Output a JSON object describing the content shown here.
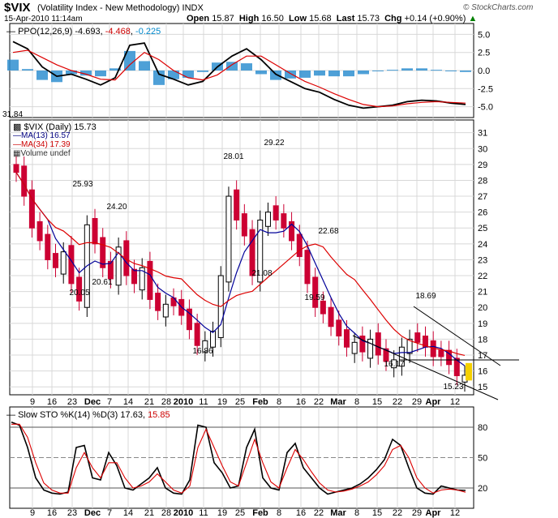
{
  "header": {
    "symbol": "$VIX",
    "name": "(Volatility Index - New Methodology)",
    "exchange": "INDX",
    "date": "15-Apr-2010 11:14am",
    "open_label": "Open",
    "open": "15.87",
    "high_label": "High",
    "high": "16.50",
    "low_label": "Low",
    "low": "15.68",
    "last_label": "Last",
    "last": "15.73",
    "chg_label": "Chg",
    "chg": "+0.14 (+0.90%)",
    "logo": "© StockCharts.com"
  },
  "ppo_panel": {
    "label": "PPO(12,26,9)",
    "v1": "-4.693",
    "v2": "-4.468",
    "v3": "-0.225",
    "ticks": [
      "5.0",
      "2.5",
      "0.0",
      "-2.5",
      "-5.0"
    ]
  },
  "price_panel": {
    "legend_main": "$VIX (Daily) 15.73",
    "legend_ma13": "MA(13) 16.57",
    "legend_ma34": "MA(34) 17.39",
    "legend_vol": "Volume undef",
    "left_value": "31.84",
    "ticks": [
      "31",
      "30",
      "29",
      "28",
      "27",
      "26",
      "25",
      "24",
      "23",
      "22",
      "21",
      "20",
      "19",
      "18",
      "17",
      "16",
      "15"
    ],
    "annotations": [
      "25.93",
      "24.20",
      "20.61",
      "20.05",
      "28.01",
      "29.22",
      "16.86",
      "21.08",
      "22.68",
      "19.59",
      "16.17",
      "18.69",
      "15.23"
    ]
  },
  "stoch_panel": {
    "label": "Slow STO %K(14) %D(3)",
    "k": "17.63",
    "d": "15.85",
    "ticks": [
      "80",
      "50",
      "20"
    ]
  },
  "x_axis": [
    "9",
    "16",
    "23",
    "Dec",
    "7",
    "14",
    "21",
    "28",
    "2010",
    "11",
    "19",
    "25",
    "Feb",
    "8",
    "16",
    "22",
    "Mar",
    "8",
    "15",
    "22",
    "29",
    "Apr",
    "12"
  ],
  "colors": {
    "up": "#000000",
    "down": "#cc0033",
    "ma13": "#000099",
    "ma34": "#dd0000",
    "ppo_hist": "#2f8fd0",
    "last_marker": "#f5d000"
  },
  "chart_data": [
    {
      "type": "line",
      "title": "PPO(12,26,9)",
      "series": [
        {
          "name": "PPO",
          "values": [
            4.0,
            3.0,
            0.5,
            -0.8,
            -0.5,
            -1.2,
            -2.0,
            -1.0,
            3.5,
            3.8,
            -0.5,
            -1.2,
            -2.0,
            -1.5,
            0.5,
            2.0,
            3.0,
            1.5,
            -0.5,
            -1.5,
            -2.5,
            -3.0,
            -4.0,
            -4.8,
            -5.2,
            -5.0,
            -4.8,
            -4.3,
            -4.1,
            -4.2,
            -4.5,
            -4.7
          ]
        },
        {
          "name": "Signal",
          "values": [
            2.5,
            2.8,
            1.8,
            0.8,
            0.0,
            -0.5,
            -1.2,
            -1.3,
            0.8,
            2.5,
            1.5,
            0.0,
            -1.0,
            -1.3,
            -0.6,
            0.8,
            2.0,
            2.0,
            0.8,
            -0.4,
            -1.5,
            -2.3,
            -3.2,
            -4.0,
            -4.7,
            -5.0,
            -4.9,
            -4.6,
            -4.4,
            -4.3,
            -4.4,
            -4.5
          ]
        }
      ],
      "ylim": [
        -6.5,
        6.5
      ]
    },
    {
      "type": "candlestick",
      "title": "$VIX (Daily) 15.73",
      "dates": [
        "2009-11-02",
        "2009-11-04",
        "2009-11-06",
        "2009-11-10",
        "2009-11-12",
        "2009-11-16",
        "2009-11-18",
        "2009-11-20",
        "2009-11-24",
        "2009-11-27",
        "2009-12-01",
        "2009-12-03",
        "2009-12-07",
        "2009-12-09",
        "2009-12-11",
        "2009-12-15",
        "2009-12-17",
        "2009-12-21",
        "2009-12-23",
        "2009-12-29",
        "2010-01-04",
        "2010-01-06",
        "2010-01-08",
        "2010-01-12",
        "2010-01-14",
        "2010-01-19",
        "2010-01-21",
        "2010-01-22",
        "2010-01-26",
        "2010-01-28",
        "2010-02-01",
        "2010-02-03",
        "2010-02-05",
        "2010-02-08",
        "2010-02-10",
        "2010-02-12",
        "2010-02-17",
        "2010-02-19",
        "2010-02-23",
        "2010-02-25",
        "2010-03-01",
        "2010-03-03",
        "2010-03-05",
        "2010-03-09",
        "2010-03-11",
        "2010-03-15",
        "2010-03-17",
        "2010-03-19",
        "2010-03-23",
        "2010-03-25",
        "2010-03-29",
        "2010-03-31",
        "2010-04-02",
        "2010-04-06",
        "2010-04-08",
        "2010-04-12",
        "2010-04-14",
        "2010-04-15"
      ],
      "close": [
        28.5,
        27.0,
        25.0,
        24.2,
        23.0,
        22.5,
        23.5,
        21.5,
        20.4,
        25.2,
        24.0,
        22.5,
        21.8,
        23.8,
        22.0,
        21.5,
        22.5,
        20.5,
        19.8,
        20.2,
        20.1,
        19.5,
        18.6,
        17.6,
        17.9,
        18.5,
        22.0,
        27.0,
        25.5,
        24.5,
        22.0,
        25.5,
        26.0,
        25.5,
        25.0,
        24.2,
        23.2,
        21.5,
        20.0,
        19.6,
        18.8,
        18.2,
        17.5,
        17.8,
        17.2,
        18.0,
        17.0,
        16.6,
        16.7,
        17.5,
        18.0,
        17.8,
        17.5,
        16.9,
        16.9,
        16.4,
        15.7,
        15.73
      ],
      "annotations": {
        "25.93": "2009-11-27",
        "24.20": "2009-12-07",
        "20.61": "2009-11-24",
        "20.05": "2009-11-24",
        "28.01": "2010-01-22",
        "29.22": "2010-02-05",
        "16.86": "2010-01-12",
        "21.08": "2010-02-03",
        "22.68": "2010-02-25",
        "19.59": "2010-03-01",
        "16.17": "2010-03-23",
        "18.69": "2010-03-29",
        "15.23": "2010-04-14"
      },
      "ylim": [
        14.5,
        31.8
      ]
    },
    {
      "type": "line",
      "title": "Slow STO %K(14) %D(3)",
      "series": [
        {
          "name": "%K",
          "values": [
            85,
            82,
            60,
            30,
            18,
            15,
            14,
            16,
            60,
            62,
            30,
            28,
            55,
            42,
            20,
            18,
            24,
            30,
            40,
            20,
            15,
            14,
            28,
            82,
            80,
            45,
            35,
            20,
            22,
            60,
            78,
            30,
            20,
            18,
            55,
            64,
            40,
            30,
            20,
            14,
            16,
            18,
            20,
            24,
            30,
            38,
            48,
            68,
            62,
            40,
            20,
            15,
            14,
            22,
            20,
            18,
            17.63
          ]
        },
        {
          "name": "%D",
          "values": [
            83,
            83,
            70,
            45,
            25,
            18,
            15,
            15,
            40,
            55,
            40,
            30,
            45,
            45,
            30,
            20,
            22,
            26,
            34,
            26,
            18,
            15,
            22,
            60,
            78,
            60,
            42,
            26,
            22,
            45,
            68,
            45,
            26,
            20,
            40,
            58,
            48,
            36,
            25,
            18,
            16,
            17,
            19,
            22,
            26,
            33,
            42,
            58,
            62,
            50,
            30,
            20,
            15,
            18,
            19,
            18,
            15.85
          ]
        }
      ],
      "ylim": [
        0,
        100
      ]
    }
  ]
}
